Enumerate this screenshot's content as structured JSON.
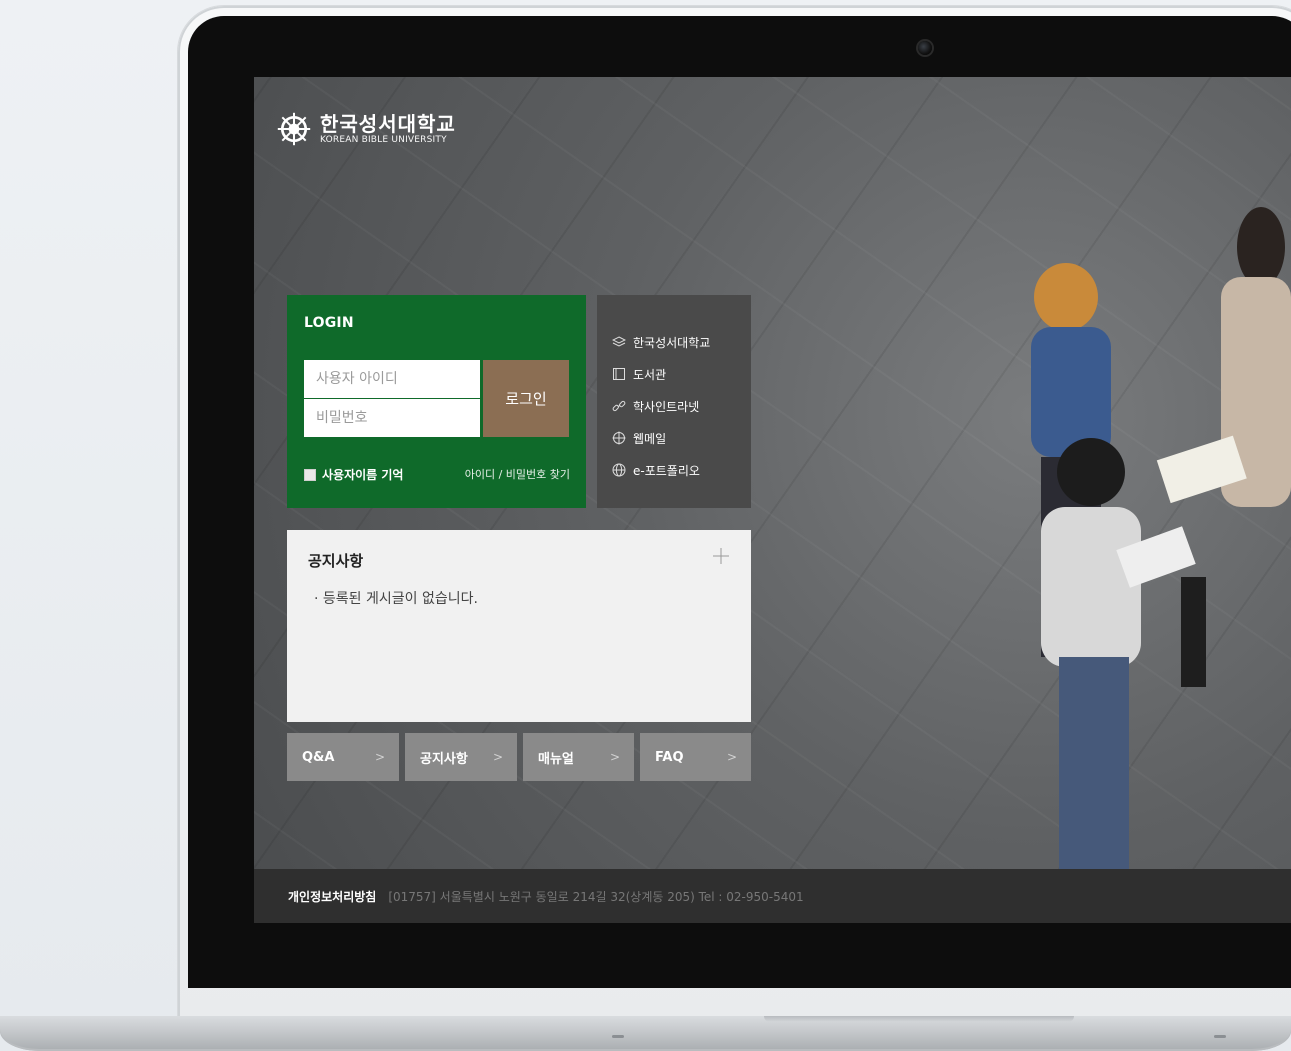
{
  "university": {
    "name_ko": "한국성서대학교",
    "name_en": "KOREAN BIBLE UNIVERSITY"
  },
  "login": {
    "title": "LOGIN",
    "user_placeholder": "사용자 아이디",
    "password_placeholder": "비밀번호",
    "button_label": "로그인",
    "remember_label": "사용자이름 기억",
    "find_link": "아이디 / 비밀번호 찾기"
  },
  "quick_links": [
    {
      "label": "한국성서대학교",
      "icon": "layers-icon"
    },
    {
      "label": "도서관",
      "icon": "book-icon"
    },
    {
      "label": "학사인트라넷",
      "icon": "link-icon"
    },
    {
      "label": "웹메일",
      "icon": "crosshair-icon"
    },
    {
      "label": "e-포트폴리오",
      "icon": "globe-icon"
    }
  ],
  "notice": {
    "title": "공지사항",
    "empty_text": "· 등록된 게시글이 없습니다."
  },
  "nav_buttons": [
    {
      "label": "Q&A"
    },
    {
      "label": "공지사항"
    },
    {
      "label": "매뉴얼"
    },
    {
      "label": "FAQ"
    }
  ],
  "footer": {
    "privacy": "개인정보처리방침",
    "address": "[01757] 서울특별시 노원구 동일로 214길 32(상계동 205)   Tel : 02-950-5401"
  },
  "colors": {
    "login_bg": "#0f6a2a",
    "login_button": "#8b6e53",
    "quick_bg": "#4a4a4a",
    "nav_button": "#8a8a8a",
    "footer_bg": "#2f2f2f"
  }
}
